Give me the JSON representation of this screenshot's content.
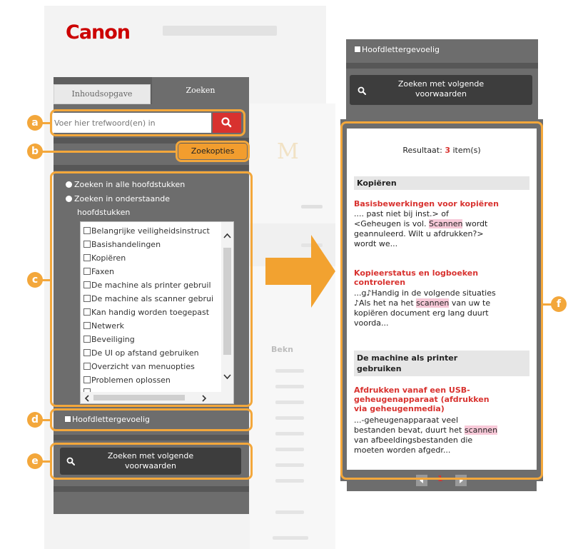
{
  "brand": {
    "logo": "Canon"
  },
  "colors": {
    "accent": "#f3a73b",
    "search_red": "#d8322f",
    "panel": "#6d6d6d",
    "link_red": "#d8322f",
    "highlight": "#f7c9d8"
  },
  "tabs": {
    "toc": "Inhoudsopgave",
    "search": "Zoeken"
  },
  "search": {
    "placeholder": "Voer hier trefwoord(en) in",
    "icon": "search-icon"
  },
  "options_button": "Zoekopties",
  "scope": {
    "all_chapters": "Zoeken in alle hoofdstukken",
    "selected_chapters_line1": "Zoeken in onderstaande",
    "selected_chapters_line2": "hoofdstukken",
    "chapters": [
      "Belangrijke veiligheidsinstruct",
      "Basishandelingen",
      "Kopiëren",
      "Faxen",
      "De machine als printer gebruil",
      "De machine als scanner gebrui",
      "Kan handig worden toegepast",
      "Netwerk",
      "Beveiliging",
      "De UI op afstand gebruiken",
      "Overzicht van menuopties",
      "Problemen oplossen"
    ]
  },
  "case_sensitive": "Hoofdlettergevoelig",
  "search_conditions": {
    "line1": "Zoeken met volgende",
    "line2": "voorwaarden"
  },
  "callouts": [
    "a",
    "b",
    "c",
    "d",
    "e",
    "f"
  ],
  "results": {
    "summary_prefix": "Resultaat: ",
    "count": "3",
    "summary_suffix": " item(s)",
    "groups": [
      {
        "heading": "Kopiëren"
      },
      {
        "heading_line1": "De machine als printer",
        "heading_line2": "gebruiken"
      }
    ],
    "items": [
      {
        "title": "Basisbewerkingen voor kopiëren",
        "snippet_before": ".... past niet bij inst.> of\n<Geheugen is vol. ",
        "snippet_mark": "Scannen",
        "snippet_after": " wordt\ngeannuleerd. Wilt u afdrukken?>\nwordt we..."
      },
      {
        "title_line1": "Kopieerstatus en logboeken",
        "title_line2": "controleren",
        "snippet_before": "...g♪Handig in de volgende situaties\n♪Als het na het ",
        "snippet_mark": "scannen",
        "snippet_after": " van uw te\nkopiëren document erg lang duurt\nvoorda..."
      },
      {
        "title_line1": "Afdrukken vanaf een USB-",
        "title_line2": "geheugenapparaat (afdrukken",
        "title_line3": "via geheugenmedia)",
        "snippet_before": "...-geheugenapparaat veel\nbestanden bevat, duurt het ",
        "snippet_mark": "scannen",
        "snippet_after": "\nvan afbeeldingsbestanden die\nmoeten worden afgedr..."
      }
    ],
    "page": "1"
  }
}
